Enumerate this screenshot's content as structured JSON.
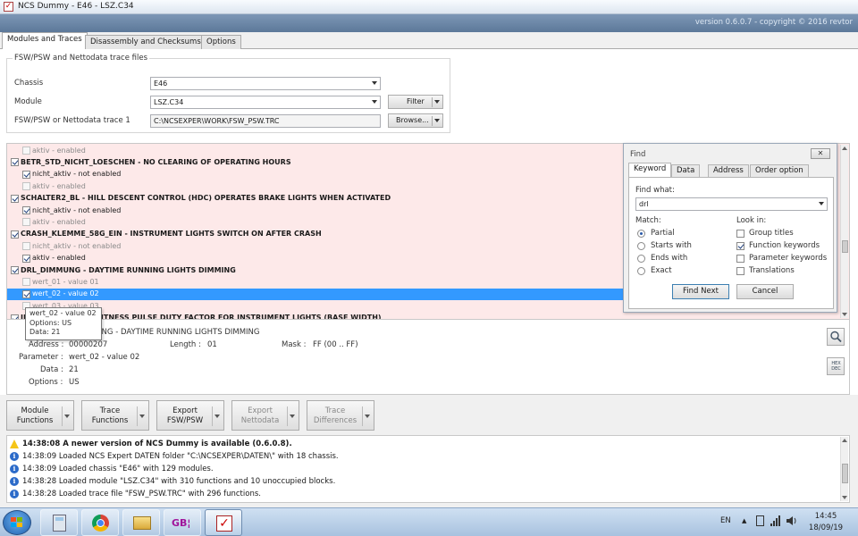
{
  "window": {
    "title": "NCS Dummy - E46 - LSZ.C34",
    "version": "version 0.6.0.7 - copyright © 2016 revtor"
  },
  "tabs": [
    "Modules and Traces",
    "Disassembly and Checksums",
    "Options"
  ],
  "config": {
    "group_title": "FSW/PSW and Nettodata trace files",
    "chassis_label": "Chassis",
    "chassis_value": "E46",
    "module_label": "Module",
    "module_value": "LSZ.C34",
    "filter_label": "Filter",
    "trace_label": "FSW/PSW or Nettodata trace 1",
    "trace_value": "C:\\NCSEXPER\\WORK\\FSW_PSW.TRC",
    "browse_label": "Browse..."
  },
  "tree": [
    {
      "text": "aktiv  -  enabled",
      "kind": "param",
      "checked": false,
      "dim": true
    },
    {
      "text": "BETR_STD_NICHT_LOESCHEN  -  NO CLEARING OF OPERATING HOURS",
      "kind": "fn",
      "checked": true,
      "dim": false
    },
    {
      "text": "nicht_aktiv  -  not enabled",
      "kind": "param",
      "checked": true,
      "dim": false
    },
    {
      "text": "aktiv  -  enabled",
      "kind": "param",
      "checked": false,
      "dim": true
    },
    {
      "text": "SCHALTER2_BL  -  HILL DESCENT CONTROL (HDC) OPERATES BRAKE LIGHTS WHEN ACTIVATED",
      "kind": "fn",
      "checked": true,
      "dim": false
    },
    {
      "text": "nicht_aktiv  -  not enabled",
      "kind": "param",
      "checked": true,
      "dim": false
    },
    {
      "text": "aktiv  -  enabled",
      "kind": "param",
      "checked": false,
      "dim": true
    },
    {
      "text": "CRASH_KLEMME_58G_EIN  -  INSTRUMENT LIGHTS SWITCH ON AFTER CRASH",
      "kind": "fn",
      "checked": true,
      "dim": false
    },
    {
      "text": "nicht_aktiv  -  not enabled",
      "kind": "param",
      "checked": false,
      "dim": true
    },
    {
      "text": "aktiv  -  enabled",
      "kind": "param",
      "checked": true,
      "dim": false
    },
    {
      "text": "DRL_DIMMUNG  -  DAYTIME RUNNING LIGHTS DIMMING",
      "kind": "fn",
      "checked": true,
      "dim": false
    },
    {
      "text": "wert_01  -  value 01",
      "kind": "param",
      "checked": false,
      "dim": true
    },
    {
      "text": "wert_02  -  value 02",
      "kind": "param",
      "checked": true,
      "dim": false,
      "selected": true
    },
    {
      "text": "wert_03  -  value 03",
      "kind": "param",
      "checked": false,
      "dim": true
    },
    {
      "text": "IN  -  MINIMUM BRIGHTNESS PULSE DUTY FACTOR FOR INSTRUMENT LIGHTS (BASE WIDTH)",
      "kind": "fn",
      "checked": true,
      "dim": false
    }
  ],
  "tooltip": {
    "line1": "wert_02  -  value 02",
    "line2": "Options: US",
    "line3": "Data: 21"
  },
  "detail": {
    "function_text": "MUNG  -  DAYTIME RUNNING LIGHTS DIMMING",
    "address_label": "Address :",
    "address_value": "00000207",
    "length_label": "Length :",
    "length_value": "01",
    "mask_label": "Mask :",
    "mask_value": "FF  (00 .. FF)",
    "parameter_label": "Parameter :",
    "parameter_value": "wert_02  -  value 02",
    "data_label": "Data :",
    "data_value": "21",
    "options_label": "Options :",
    "options_value": "US",
    "hexdec_label": "HEX DEC"
  },
  "find": {
    "title": "Find",
    "close": "✕",
    "tabs": [
      "Keyword",
      "Data",
      "Address",
      "Order option"
    ],
    "find_what_label": "Find what:",
    "find_what_value": "drl",
    "match_label": "Match:",
    "match_options": [
      "Partial",
      "Starts with",
      "Ends with",
      "Exact"
    ],
    "match_selected": 0,
    "lookin_label": "Look in:",
    "lookin_options": [
      "Group titles",
      "Function keywords",
      "Parameter keywords",
      "Translations"
    ],
    "lookin_checked": [
      false,
      true,
      false,
      false
    ],
    "find_next": "Find Next",
    "cancel": "Cancel"
  },
  "actions": [
    {
      "line1": "Module",
      "line2": "Functions",
      "enabled": true
    },
    {
      "line1": "Trace",
      "line2": "Functions",
      "enabled": true
    },
    {
      "line1": "Export",
      "line2": "FSW/PSW",
      "enabled": true
    },
    {
      "line1": "Export",
      "line2": "Nettodata",
      "enabled": false
    },
    {
      "line1": "Trace",
      "line2": "Differences",
      "enabled": false
    }
  ],
  "log": [
    {
      "text": "14:38:08  A newer version of NCS Dummy is available (0.6.0.8).",
      "type": "warn"
    },
    {
      "text": "14:38:09  Loaded NCS Expert DATEN folder \"C:\\NCSEXPER\\DATEN\\\" with 18 chassis.",
      "type": "info"
    },
    {
      "text": "14:38:09  Loaded chassis \"E46\" with 129 modules.",
      "type": "info"
    },
    {
      "text": "14:38:28  Loaded module \"LSZ.C34\" with 310 functions and 10 unoccupied blocks.",
      "type": "info"
    },
    {
      "text": "14:38:28  Loaded trace file \"FSW_PSW.TRC\" with 296 functions.",
      "type": "info"
    }
  ],
  "taskbar": {
    "language": "EN",
    "time": "14:45",
    "date": "18/09/19",
    "app_badge": "GB¦"
  }
}
